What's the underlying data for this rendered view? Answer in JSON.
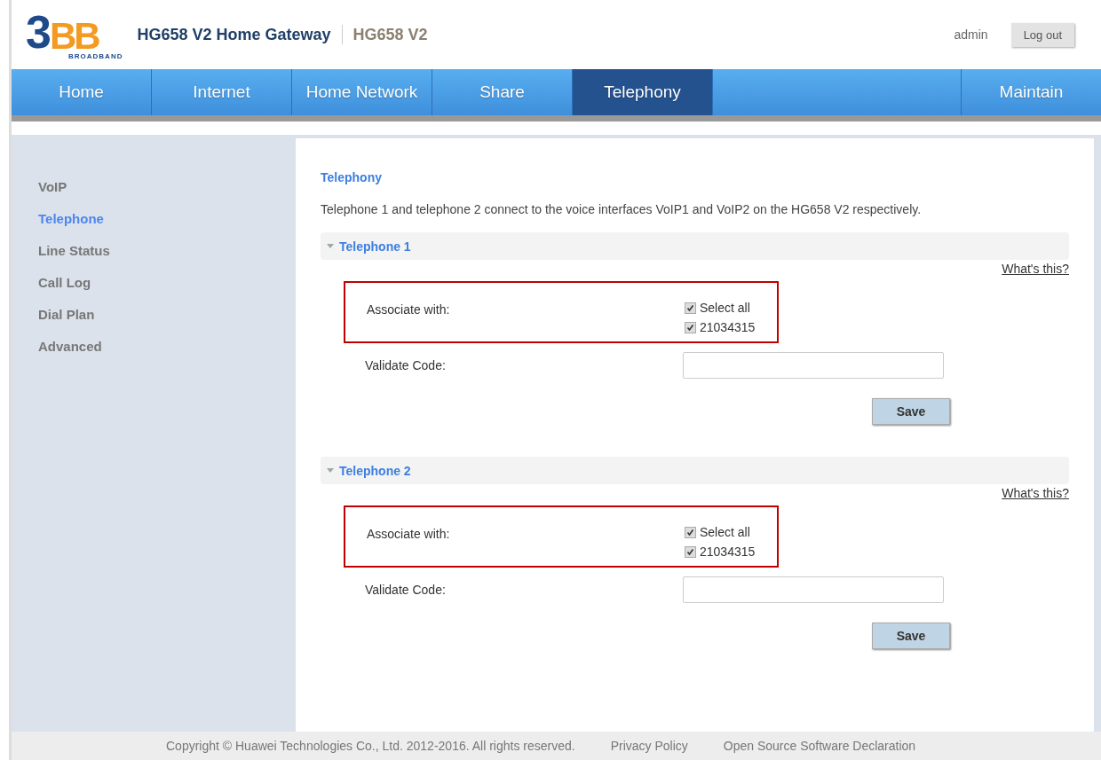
{
  "header": {
    "logo": {
      "digit": "3",
      "letters": "BB",
      "tagline": "BROADBAND"
    },
    "title": "HG658 V2 Home Gateway",
    "model": "HG658 V2",
    "user": "admin",
    "logout": "Log out"
  },
  "nav": [
    {
      "label": "Home",
      "selected": false
    },
    {
      "label": "Internet",
      "selected": false
    },
    {
      "label": "Home Network",
      "selected": false
    },
    {
      "label": "Share",
      "selected": false
    },
    {
      "label": "Telephony",
      "selected": true
    },
    {
      "label": "Maintain",
      "selected": false
    }
  ],
  "sidebar": [
    {
      "label": "VoIP",
      "selected": false
    },
    {
      "label": "Telephone",
      "selected": true
    },
    {
      "label": "Line Status",
      "selected": false
    },
    {
      "label": "Call Log",
      "selected": false
    },
    {
      "label": "Dial Plan",
      "selected": false
    },
    {
      "label": "Advanced",
      "selected": false
    }
  ],
  "content": {
    "heading": "Telephony",
    "description": "Telephone 1 and telephone 2 connect to the voice interfaces VoIP1 and VoIP2 on the HG658 V2 respectively.",
    "sections": [
      {
        "title": "Telephone 1",
        "expanded": true,
        "help": "What's this?",
        "highlighted": true,
        "associate_label": "Associate with:",
        "options": [
          {
            "label": "Select all",
            "checked": true
          },
          {
            "label": "21034315",
            "checked": true
          }
        ],
        "code_label": "Validate Code:",
        "save": "Save"
      },
      {
        "title": "Telephone 2",
        "expanded": true,
        "help": "What's this?",
        "highlighted": true,
        "associate_label": "Associate with:",
        "options": [
          {
            "label": "Select all",
            "checked": true
          },
          {
            "label": "21034315",
            "checked": true
          }
        ],
        "code_label": "Validate Code:",
        "save": "Save"
      }
    ]
  },
  "footer": {
    "copyright": "Copyright © Huawei Technologies Co., Ltd. 2012-2016. All rights reserved.",
    "links": [
      "Privacy Policy",
      "Open Source Software Declaration"
    ]
  }
}
